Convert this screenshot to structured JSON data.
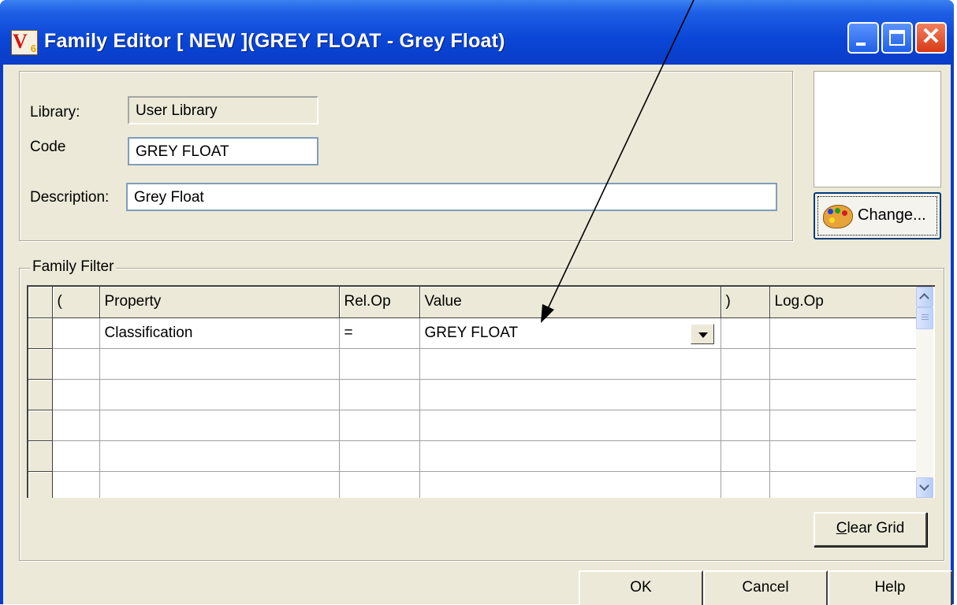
{
  "window": {
    "title": "Family Editor  [ NEW ](GREY FLOAT - Grey Float)",
    "app_icon": {
      "letter": "V",
      "digit": "6"
    },
    "controls": {
      "minimize": "minimize-icon",
      "maximize": "maximize-icon",
      "close": "✕"
    }
  },
  "form": {
    "library_label": "Library:",
    "library_value": "User Library",
    "code_label": "Code",
    "code_value": "GREY FLOAT",
    "description_label": "Description:",
    "description_value": "Grey Float"
  },
  "change_button": {
    "label": "Change...",
    "icon": "paint-palette-icon"
  },
  "family_filter": {
    "legend": "Family Filter",
    "columns": [
      "(",
      "Property",
      "Rel.Op",
      "Value",
      ")",
      "Log.Op"
    ],
    "rows": [
      {
        "open": "",
        "property": "Classification",
        "relop": "=",
        "value": "GREY FLOAT",
        "close": "",
        "logop": ""
      }
    ],
    "empty_rows": 5
  },
  "buttons": {
    "clear_grid_mnemonic": "C",
    "clear_grid_rest": "lear Grid",
    "ok": "OK",
    "cancel": "Cancel",
    "help": "Help"
  },
  "colors": {
    "titlebar": "#0a46d6",
    "face": "#ece9d8",
    "close_button": "#d83a15"
  }
}
